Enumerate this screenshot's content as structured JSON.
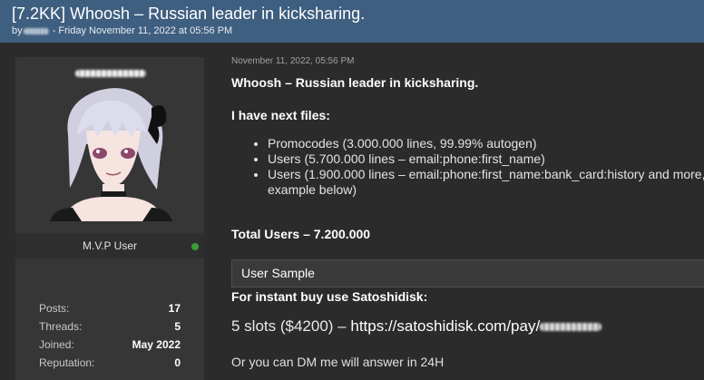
{
  "thread": {
    "title": "[7.2KK] Whoosh – Russian leader in kicksharing.",
    "meta_prefix": "by",
    "meta_suffix": "- Friday November 11, 2022 at 05:56 PM"
  },
  "user": {
    "title": "M.V.P User",
    "status_color": "#3a9b3a",
    "stats": [
      {
        "label": "Posts:",
        "value": "17"
      },
      {
        "label": "Threads:",
        "value": "5"
      },
      {
        "label": "Joined:",
        "value": "May 2022"
      },
      {
        "label": "Reputation:",
        "value": "0"
      }
    ]
  },
  "post": {
    "date": "November 11, 2022, 05:56 PM",
    "heading": "Whoosh – Russian leader in kicksharing.",
    "files_heading": "I have next files:",
    "files": [
      "Promocodes (3.000.000 lines, 99.99% autogen)",
      "Users (5.700.000 lines – email:phone:first_name)",
      "Users (1.900.000 lines – email:phone:first_name:bank_card:history and more, example below)"
    ],
    "total_users": "Total Users – 7.200.000",
    "spoiler_label": "User Sample",
    "instant_buy": "For instant buy use Satoshidisk:",
    "slots_text": "5 slots ($4200) – ",
    "pay_link": "https://satoshidisk.com/pay/",
    "dm_text": "Or you can DM me will answer in 24H"
  },
  "colors": {
    "header_bg": "#3f5f80",
    "page_bg": "#2b2b2b",
    "panel_bg": "#363636"
  }
}
